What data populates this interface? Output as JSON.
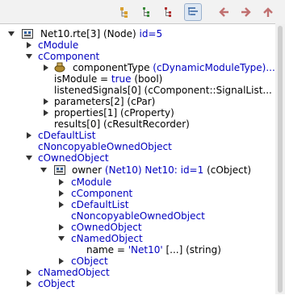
{
  "toolbar": {
    "buttons": [
      {
        "name": "mode-a-icon",
        "color": "#c08000"
      },
      {
        "name": "mode-b-icon",
        "color": "#3a8a3a"
      },
      {
        "name": "mode-c-icon",
        "color": "#b03030"
      },
      {
        "name": "mode-d-icon",
        "color": "#3060a0",
        "active": true
      }
    ],
    "nav": [
      {
        "name": "back-arrow-icon",
        "color": "#c07070"
      },
      {
        "name": "forward-arrow-icon",
        "color": "#c07070"
      },
      {
        "name": "up-arrow-icon",
        "color": "#c07070"
      }
    ]
  },
  "tree": {
    "root": {
      "black": "Net10.rte[3] (Node) ",
      "blue": "id=5"
    },
    "r1": {
      "blue": "cModule"
    },
    "r2": {
      "blue": "cComponent"
    },
    "r3": {
      "black": "componentType ",
      "blue": "(cDynamicModuleType)..."
    },
    "r4": {
      "black": "isModule = ",
      "blue": "true",
      "black2": " (bool)"
    },
    "r5": {
      "black": "listenedSignals[0] (cComponent::SignalList..."
    },
    "r6": {
      "black": "parameters[2] (cPar)"
    },
    "r7": {
      "black": "properties[1] (cProperty)"
    },
    "r8": {
      "black": "results[0] (cResultRecorder)"
    },
    "r9": {
      "blue": "cDefaultList"
    },
    "r10": {
      "blue": "cNoncopyableOwnedObject"
    },
    "r11": {
      "blue": "cOwnedObject"
    },
    "r12": {
      "black": "owner ",
      "blue": "(Net10) Net10: id=1",
      "black2": " (cObject)"
    },
    "r13": {
      "blue": "cModule"
    },
    "r14": {
      "blue": "cComponent"
    },
    "r15": {
      "blue": "cDefaultList"
    },
    "r16": {
      "blue": "cNoncopyableOwnedObject"
    },
    "r17": {
      "blue": "cOwnedObject"
    },
    "r18": {
      "blue": "cNamedObject"
    },
    "r19": {
      "black": "name = ",
      "blue": "'Net10'",
      "black2": " [...]  (string)"
    },
    "r20": {
      "blue": "cObject"
    },
    "r21": {
      "blue": "cNamedObject"
    },
    "r22": {
      "blue": "cObject"
    }
  }
}
